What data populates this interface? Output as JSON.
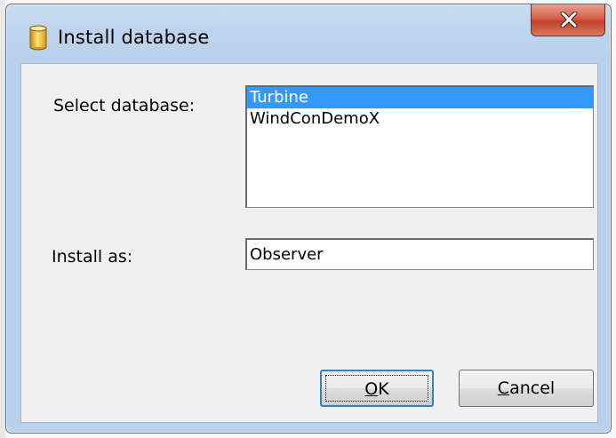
{
  "window": {
    "title": "Install database",
    "icon": "database-icon",
    "close_icon": "close-icon"
  },
  "form": {
    "select_label": "Select database:",
    "install_label": "Install as:",
    "databases": [
      {
        "label": "Turbine",
        "selected": true
      },
      {
        "label": "WindConDemoX",
        "selected": false
      }
    ],
    "install_as_value": "Observer"
  },
  "buttons": {
    "ok_mnemonic": "O",
    "ok_rest": "K",
    "cancel_mnemonic": "C",
    "cancel_rest": "ancel"
  },
  "colors": {
    "selection": "#3399ff",
    "close_button": "#c2402a",
    "titlebar": "#bed4ee"
  }
}
